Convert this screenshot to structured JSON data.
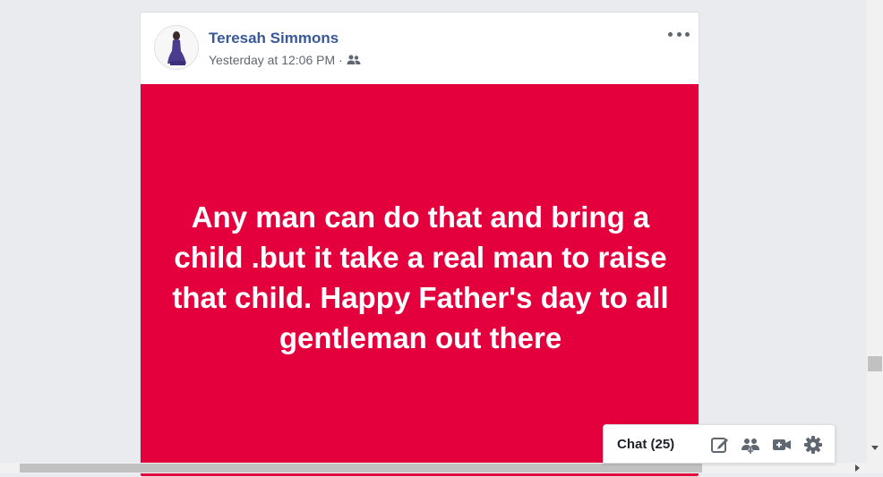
{
  "post": {
    "author": "Teresah Simmons",
    "timestamp": "Yesterday at 12:06 PM",
    "separator": "·",
    "audience_icon": "friends-icon",
    "more_icon": "more-options-icon",
    "text": "Any man can do that and bring a child .but it take a real man to raise that child. Happy Father's day to all gentleman out there",
    "background_color": "#e3003c"
  },
  "chat": {
    "label": "Chat (25)",
    "icons": [
      "new-message-icon",
      "create-group-icon",
      "video-call-icon",
      "settings-gear-icon"
    ]
  }
}
